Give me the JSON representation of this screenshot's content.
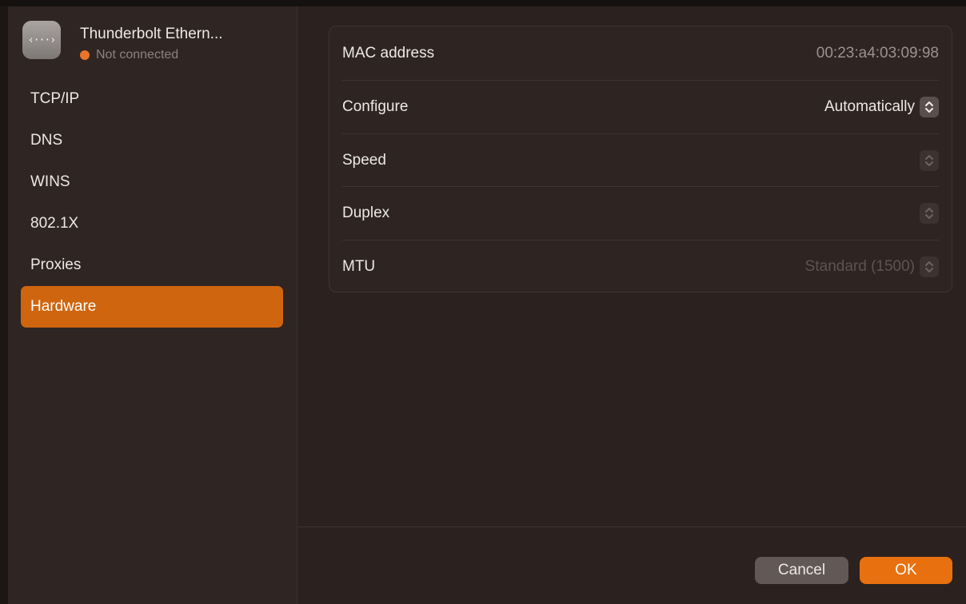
{
  "interface": {
    "name": "Thunderbolt Ethern...",
    "status": "Not connected",
    "icon": "network-arrows-icon",
    "status_color": "#e8742a"
  },
  "sidebar": {
    "items": [
      {
        "label": "TCP/IP",
        "active": false
      },
      {
        "label": "DNS",
        "active": false
      },
      {
        "label": "WINS",
        "active": false
      },
      {
        "label": "802.1X",
        "active": false
      },
      {
        "label": "Proxies",
        "active": false
      },
      {
        "label": "Hardware",
        "active": true
      }
    ]
  },
  "hardware": {
    "rows": [
      {
        "label": "MAC address",
        "value": "00:23:a4:03:09:98",
        "control": "none"
      },
      {
        "label": "Configure",
        "value": "Automatically",
        "control": "popup-enabled"
      },
      {
        "label": "Speed",
        "value": "",
        "control": "popup-disabled"
      },
      {
        "label": "Duplex",
        "value": "",
        "control": "popup-disabled"
      },
      {
        "label": "MTU",
        "value": "Standard (1500)",
        "control": "popup-disabled"
      }
    ]
  },
  "footer": {
    "cancel_label": "Cancel",
    "ok_label": "OK"
  },
  "colors": {
    "accent": "#d0650f",
    "ok_button": "#e8700e"
  }
}
